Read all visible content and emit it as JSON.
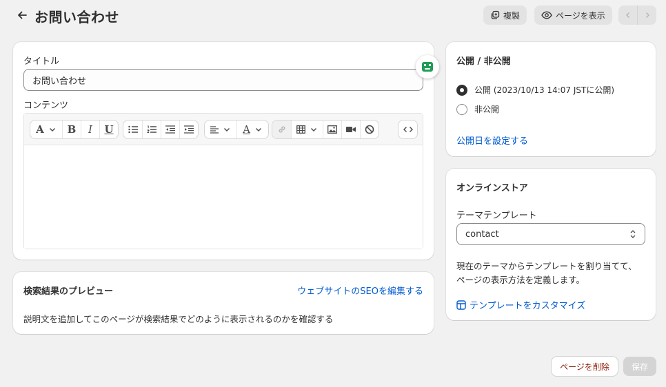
{
  "header": {
    "title": "お問い合わせ",
    "duplicate_label": "複製",
    "view_page_label": "ページを表示"
  },
  "content_card": {
    "title_label": "タイトル",
    "title_value": "お問い合わせ",
    "content_label": "コンテンツ"
  },
  "seo_card": {
    "title": "検索結果のプレビュー",
    "edit_link": "ウェブサイトのSEOを編集する",
    "description": "説明文を追加してこのページが検索結果でどのように表示されるのかを確認する"
  },
  "visibility_card": {
    "title": "公開 / 非公開",
    "options": [
      {
        "label": "公開 (2023/10/13 14:07 JSTに公開)",
        "selected": true
      },
      {
        "label": "非公開",
        "selected": false
      }
    ],
    "set_date_link": "公開日を設定する"
  },
  "online_store_card": {
    "title": "オンラインストア",
    "template_label": "テーマテンプレート",
    "template_value": "contact",
    "help_line1": "現在のテーマからテンプレートを割り当てて、",
    "help_line2": "ページの表示方法を定義します。",
    "customize_link": "テンプレートをカスタマイズ"
  },
  "footer": {
    "delete_label": "ページを削除",
    "save_label": "保存"
  },
  "colors": {
    "background": "#f1f1f1",
    "link": "#005bd3",
    "danger": "#8e1f0b",
    "badge_accent": "#1f9d55"
  }
}
